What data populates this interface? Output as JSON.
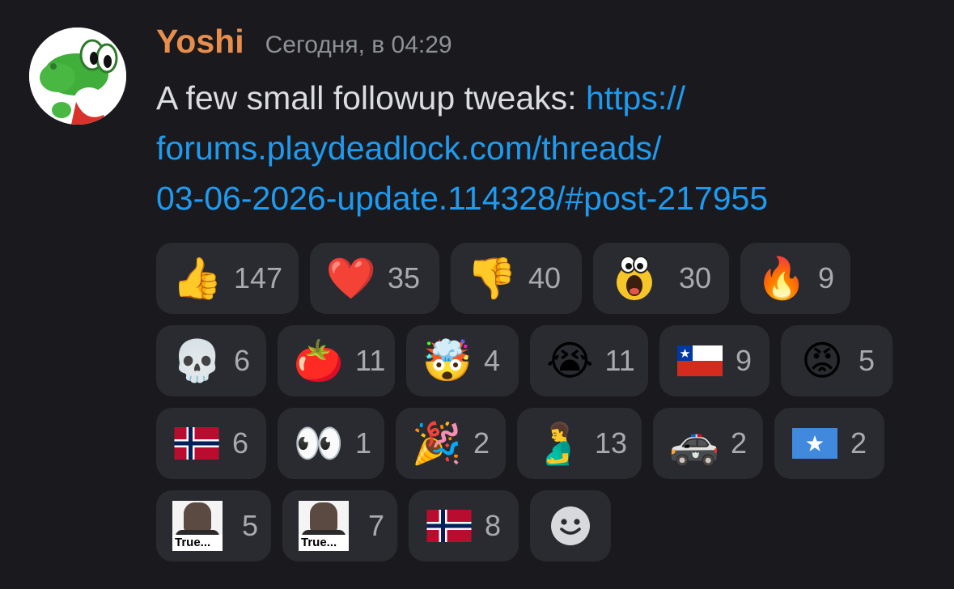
{
  "message": {
    "author": "Yoshi",
    "timestamp": "Сегодня, в 04:29",
    "text_prefix": "A few small followup tweaks: ",
    "link_lines": [
      "https://",
      "forums.playdeadlock.com/threads/",
      "03-06-2026-update.114328/#post-217955"
    ],
    "author_color": "#e88e4d",
    "link_color": "#1e9bf0"
  },
  "reactions": [
    {
      "emoji": "👍",
      "icon": "thumbs-up-icon",
      "count": "147"
    },
    {
      "emoji": "❤️",
      "icon": "red-heart-icon",
      "count": "35"
    },
    {
      "emoji": "👎",
      "icon": "thumbs-down-icon",
      "count": "40"
    },
    {
      "emoji": "",
      "icon": "screaming-yellow-custom-icon",
      "count": "30"
    },
    {
      "emoji": "🔥",
      "icon": "fire-icon",
      "count": "9"
    },
    {
      "emoji": "💀",
      "icon": "skull-icon",
      "count": "6"
    },
    {
      "emoji": "🍅",
      "icon": "tomato-icon",
      "count": "11"
    },
    {
      "emoji": "🤯",
      "icon": "exploding-head-icon",
      "count": "4"
    },
    {
      "emoji": "😭",
      "icon": "loudly-crying-face-icon",
      "count": "11"
    },
    {
      "emoji": "🇨🇱",
      "icon": "chile-flag-icon",
      "count": "9"
    },
    {
      "emoji": "😡",
      "icon": "angry-face-icon",
      "count": "5"
    },
    {
      "emoji": "🇳🇴",
      "icon": "norway-flag-icon",
      "count": "6"
    },
    {
      "emoji": "👀",
      "icon": "eyes-icon",
      "count": "1"
    },
    {
      "emoji": "🎉",
      "icon": "party-popper-icon",
      "count": "2"
    },
    {
      "emoji": "🫃",
      "icon": "pregnant-man-icon",
      "count": "13"
    },
    {
      "emoji": "🚓",
      "icon": "police-car-icon",
      "count": "2"
    },
    {
      "emoji": "🇸🇴",
      "icon": "somalia-flag-icon",
      "count": "2"
    },
    {
      "emoji": "",
      "icon": "true-meme-custom-icon",
      "caption": "True...",
      "count": "5"
    },
    {
      "emoji": "",
      "icon": "true-meme-custom-icon",
      "caption": "True...",
      "count": "7"
    },
    {
      "emoji": "🇳🇴",
      "icon": "norway-flag-icon",
      "count": "8"
    }
  ],
  "add_reaction": {
    "icon": "add-reaction-smiley-icon"
  }
}
